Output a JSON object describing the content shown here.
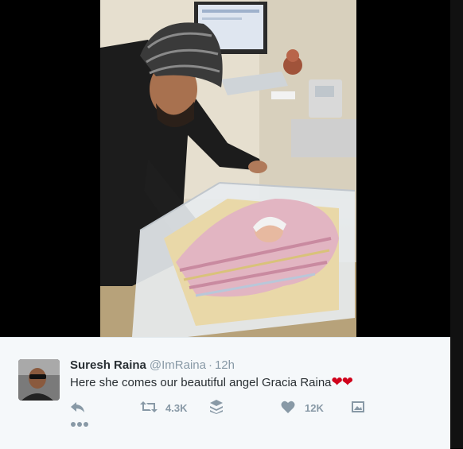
{
  "tweet": {
    "name": "Suresh Raina",
    "handle": "@ImRaina",
    "separator": "·",
    "time": "12h",
    "text": "Here she comes our beautiful angel Gracia Raina",
    "emoji": "❤❤",
    "retweet_count": "4.3K",
    "like_count": "12K"
  },
  "icons": {
    "reply": "reply-icon",
    "retweet": "retweet-icon",
    "layers": "layers-icon",
    "like": "heart-icon",
    "photo": "photo-icon",
    "more": "more-icon"
  },
  "colors": {
    "name": "#292f33",
    "meta": "#8899a6",
    "heart": "#d0021b",
    "background": "#f5f8fa"
  }
}
